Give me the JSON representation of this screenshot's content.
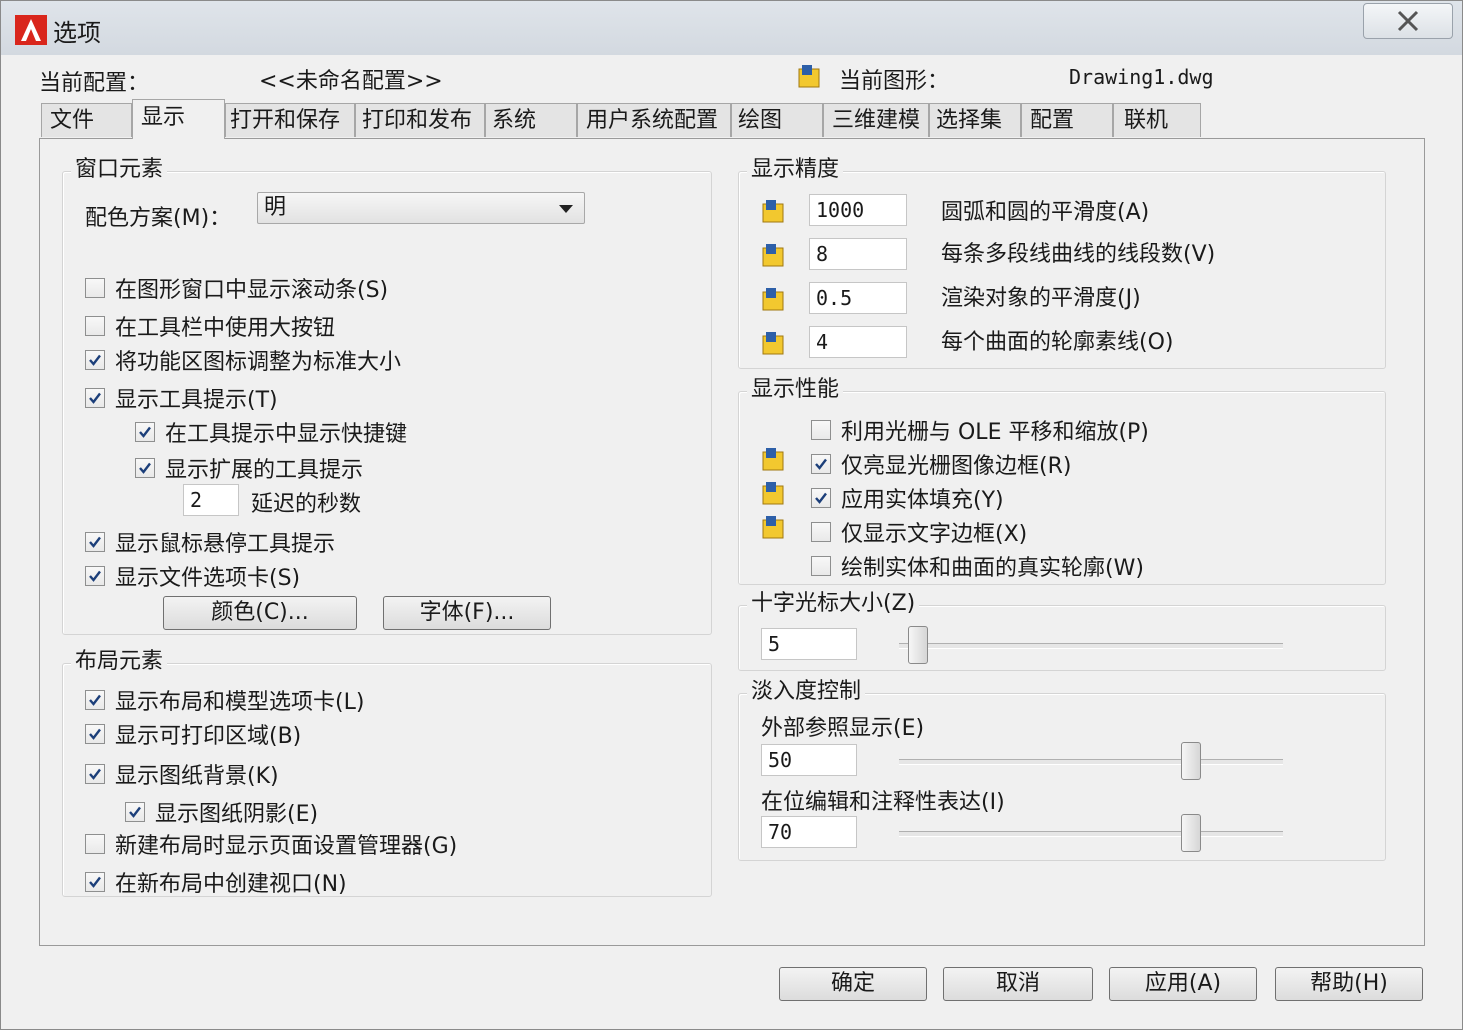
{
  "window": {
    "title": "选项",
    "close_label": "✕"
  },
  "header": {
    "profile_label": "当前配置：",
    "profile_value": "<<未命名配置>>",
    "drawing_label": "当前图形：",
    "drawing_value": "Drawing1.dwg"
  },
  "tabs": [
    {
      "label": "文件",
      "active": false
    },
    {
      "label": "显示",
      "active": true
    },
    {
      "label": "打开和保存",
      "active": false
    },
    {
      "label": "打印和发布",
      "active": false
    },
    {
      "label": "系统",
      "active": false
    },
    {
      "label": "用户系统配置",
      "active": false
    },
    {
      "label": "绘图",
      "active": false
    },
    {
      "label": "三维建模",
      "active": false
    },
    {
      "label": "选择集",
      "active": false
    },
    {
      "label": "配置",
      "active": false
    },
    {
      "label": "联机",
      "active": false
    }
  ],
  "window_elements": {
    "title": "窗口元素",
    "color_scheme_label": "配色方案(M)：",
    "color_scheme_value": "明",
    "options": [
      {
        "label": "在图形窗口中显示滚动条(S)",
        "checked": false
      },
      {
        "label": "在工具栏中使用大按钮",
        "checked": false
      },
      {
        "label": "将功能区图标调整为标准大小",
        "checked": true
      },
      {
        "label": "显示工具提示(T)",
        "checked": true
      },
      {
        "label": "在工具提示中显示快捷键",
        "checked": true
      },
      {
        "label": "显示扩展的工具提示",
        "checked": true
      },
      {
        "label": "显示鼠标悬停工具提示",
        "checked": true
      },
      {
        "label": "显示文件选项卡(S)",
        "checked": true
      }
    ],
    "delay_value": "2",
    "delay_label": "延迟的秒数",
    "colors_button": "颜色(C)...",
    "fonts_button": "字体(F)..."
  },
  "layout_elements": {
    "title": "布局元素",
    "options": [
      {
        "label": "显示布局和模型选项卡(L)",
        "checked": true
      },
      {
        "label": "显示可打印区域(B)",
        "checked": true
      },
      {
        "label": "显示图纸背景(K)",
        "checked": true
      },
      {
        "label": "显示图纸阴影(E)",
        "checked": true
      },
      {
        "label": "新建布局时显示页面设置管理器(G)",
        "checked": false
      },
      {
        "label": "在新布局中创建视口(N)",
        "checked": true
      }
    ]
  },
  "display_resolution": {
    "title": "显示精度",
    "rows": [
      {
        "value": "1000",
        "label": "圆弧和圆的平滑度(A)"
      },
      {
        "value": "8",
        "label": "每条多段线曲线的线段数(V)"
      },
      {
        "value": "0.5",
        "label": "渲染对象的平滑度(J)"
      },
      {
        "value": "4",
        "label": "每个曲面的轮廓素线(O)"
      }
    ]
  },
  "display_performance": {
    "title": "显示性能",
    "options": [
      {
        "label": "利用光栅与 OLE 平移和缩放(P)",
        "checked": false
      },
      {
        "label": "仅亮显光栅图像边框(R)",
        "checked": true
      },
      {
        "label": "应用实体填充(Y)",
        "checked": true
      },
      {
        "label": "仅显示文字边框(X)",
        "checked": false
      },
      {
        "label": "绘制实体和曲面的真实轮廓(W)",
        "checked": false
      }
    ]
  },
  "crosshair": {
    "title": "十字光标大小(Z)",
    "value": "5",
    "slider_fraction": 0.05
  },
  "fade_control": {
    "title": "淡入度控制",
    "xref_label": "外部参照显示(E)",
    "xref_value": "50",
    "xref_fraction": 0.76,
    "inplace_label": "在位编辑和注释性表达(I)",
    "inplace_value": "70",
    "inplace_fraction": 0.76
  },
  "footer": {
    "ok": "确定",
    "cancel": "取消",
    "apply": "应用(A)",
    "help": "帮助(H)"
  },
  "colors": {
    "logo_red": "#d9261c",
    "icon_yellow": "#f2c82f",
    "icon_blue": "#2d5fa8"
  }
}
